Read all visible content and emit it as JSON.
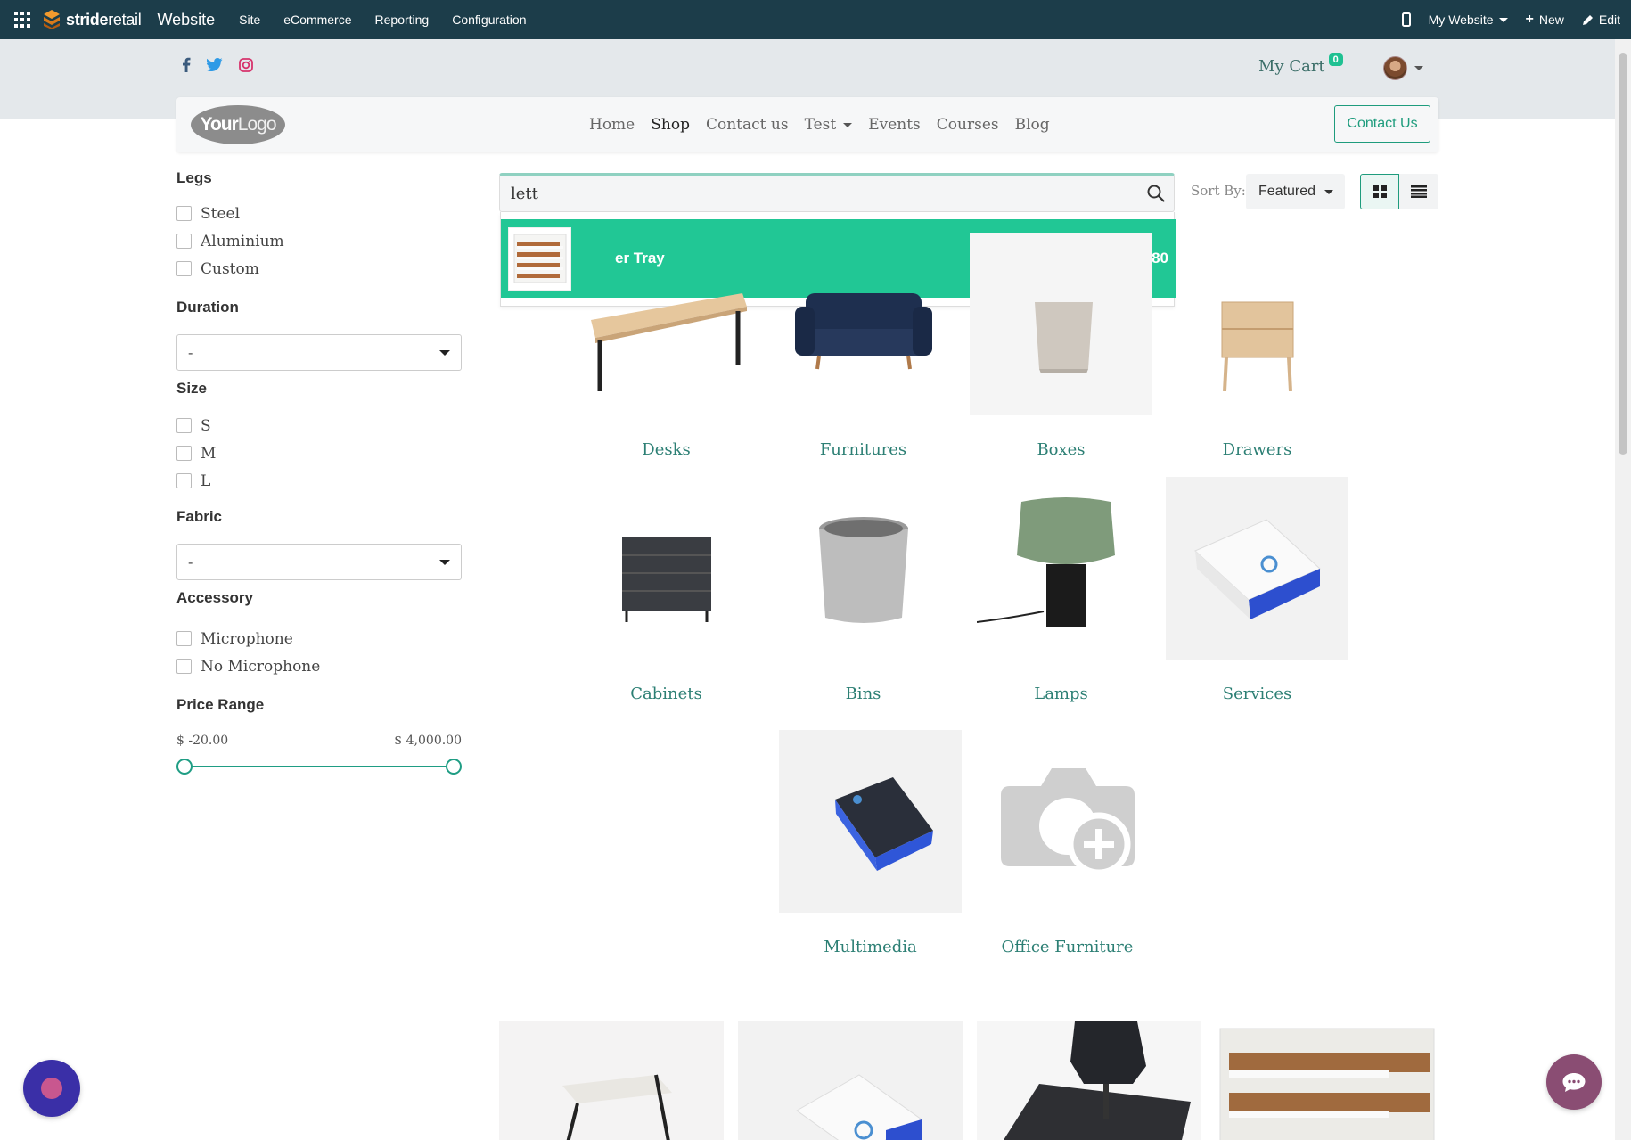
{
  "adminbar": {
    "brand_bold": "stride",
    "brand_light": "retail",
    "app_name": "Website",
    "menu": [
      "Site",
      "eCommerce",
      "Reporting",
      "Configuration"
    ],
    "my_website": "My Website",
    "new_label": "New",
    "edit_label": "Edit"
  },
  "header": {
    "cart_label": "My Cart",
    "cart_count": "0"
  },
  "navbar": {
    "logo_bold": "Your",
    "logo_light": "Logo",
    "items": [
      "Home",
      "Shop",
      "Contact us",
      "Test",
      "Events",
      "Courses",
      "Blog"
    ],
    "active": "Shop",
    "contact_button": "Contact Us"
  },
  "filters": {
    "legs": {
      "title": "Legs",
      "options": [
        "Steel",
        "Aluminium",
        "Custom"
      ]
    },
    "duration": {
      "title": "Duration",
      "value": "-"
    },
    "size": {
      "title": "Size",
      "options": [
        "S",
        "M",
        "L"
      ]
    },
    "fabric": {
      "title": "Fabric",
      "value": "-"
    },
    "accessory": {
      "title": "Accessory",
      "options": [
        "Microphone",
        "No Microphone"
      ]
    },
    "price": {
      "title": "Price Range",
      "min": "$ -20.00",
      "max": "$ 4,000.00"
    }
  },
  "search": {
    "value": "lett",
    "result_name": "er Tray",
    "result_price": "$ 4.80"
  },
  "sort": {
    "label": "Sort By:",
    "value": "Featured"
  },
  "categories": [
    "Desks",
    "Furnitures",
    "Boxes",
    "Drawers",
    "Cabinets",
    "Bins",
    "Lamps",
    "Services",
    "Multimedia",
    "Office Furniture"
  ],
  "colors": {
    "adminbar": "#1c3d4a",
    "accent": "#1e9c7d",
    "search_highlight": "#21c795",
    "category_label": "#2c7f74"
  }
}
